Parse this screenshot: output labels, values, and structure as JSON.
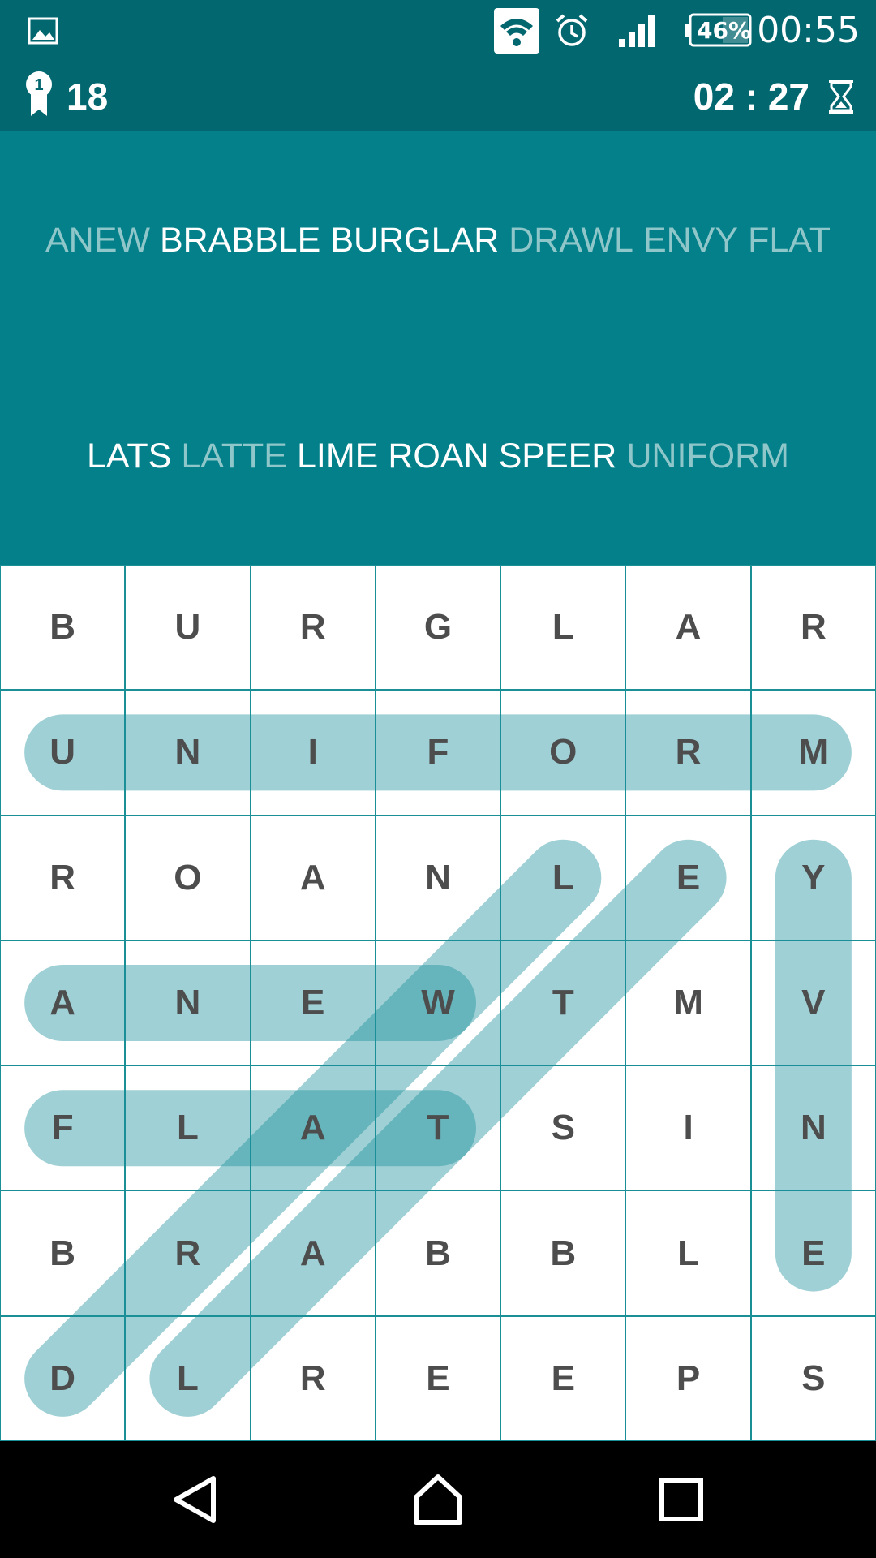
{
  "status_bar": {
    "time": "00:55",
    "battery_percent": "46%",
    "icons": [
      "image-notification-icon",
      "wifi-icon",
      "alarm-icon",
      "signal-icon",
      "battery-icon"
    ]
  },
  "toolbar": {
    "score": "18",
    "timer": "02 : 27",
    "icons": [
      "ribbon-badge-icon",
      "hourglass-icon"
    ]
  },
  "word_list": {
    "rows": [
      [
        {
          "text": "ANEW",
          "found": true
        },
        {
          "text": "BRABBLE",
          "found": false
        },
        {
          "text": "BURGLAR",
          "found": false
        },
        {
          "text": "DRAWL",
          "found": true
        },
        {
          "text": "ENVY",
          "found": true
        },
        {
          "text": "FLAT",
          "found": true
        }
      ],
      [
        {
          "text": "LATS",
          "found": false
        },
        {
          "text": "LATTE",
          "found": true
        },
        {
          "text": "LIME",
          "found": false
        },
        {
          "text": "ROAN",
          "found": false
        },
        {
          "text": "SPEER",
          "found": false
        },
        {
          "text": "UNIFORM",
          "found": true
        }
      ]
    ]
  },
  "grid": {
    "rows": [
      [
        "B",
        "U",
        "R",
        "G",
        "L",
        "A",
        "R"
      ],
      [
        "U",
        "N",
        "I",
        "F",
        "O",
        "R",
        "M"
      ],
      [
        "R",
        "O",
        "A",
        "N",
        "L",
        "E",
        "Y"
      ],
      [
        "A",
        "N",
        "E",
        "W",
        "T",
        "M",
        "V"
      ],
      [
        "F",
        "L",
        "A",
        "T",
        "S",
        "I",
        "N"
      ],
      [
        "B",
        "R",
        "A",
        "B",
        "B",
        "L",
        "E"
      ],
      [
        "D",
        "L",
        "R",
        "E",
        "E",
        "P",
        "S"
      ]
    ],
    "found_highlights": [
      {
        "word": "UNIFORM",
        "from": [
          1,
          0
        ],
        "to": [
          1,
          6
        ]
      },
      {
        "word": "ANEW",
        "from": [
          3,
          0
        ],
        "to": [
          3,
          3
        ]
      },
      {
        "word": "FLAT",
        "from": [
          4,
          0
        ],
        "to": [
          4,
          3
        ]
      },
      {
        "word": "ENVY",
        "from": [
          5,
          6
        ],
        "to": [
          2,
          6
        ]
      },
      {
        "word": "DRAWL",
        "from": [
          6,
          0
        ],
        "to": [
          2,
          4
        ]
      },
      {
        "word": "LATTE",
        "from": [
          6,
          1
        ],
        "to": [
          2,
          5
        ]
      }
    ],
    "highlight_color": "#1a8f9a"
  },
  "colors": {
    "status_bar": "#02676f",
    "word_area": "#038089",
    "found_word": "#8ec6c9",
    "pending_word": "#ffffff",
    "grid_line": "#1a8f95",
    "letter": "#4d4d4d"
  },
  "nav_bar": {
    "icons": [
      "back-icon",
      "home-icon",
      "recents-icon"
    ]
  }
}
